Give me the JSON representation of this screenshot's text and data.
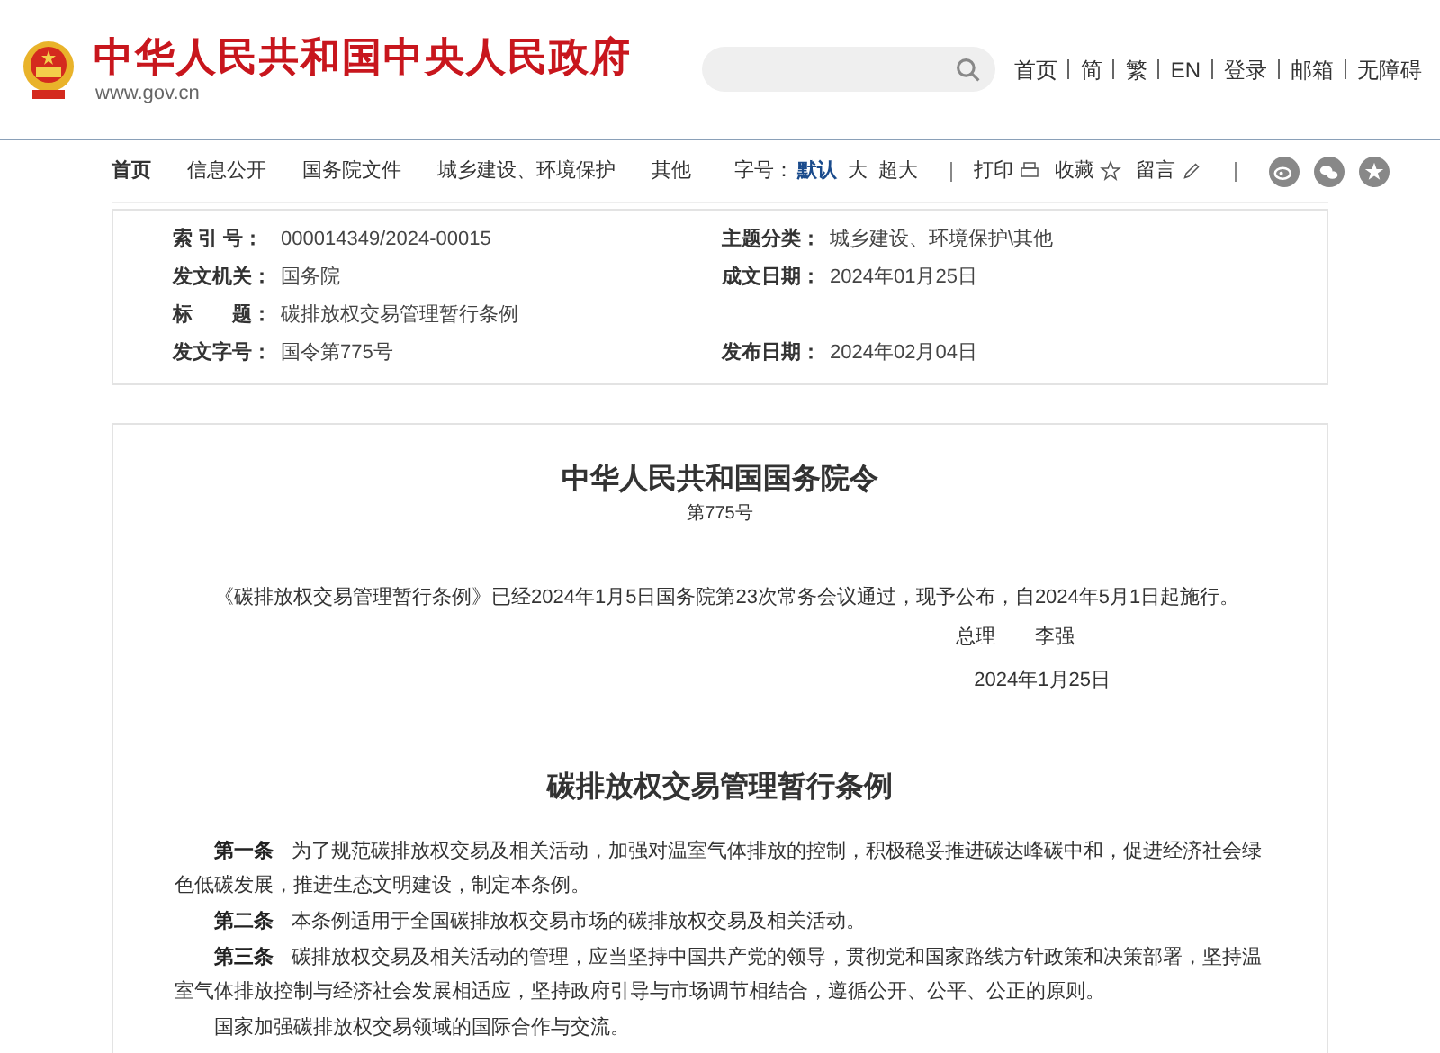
{
  "header": {
    "site_title": "中华人民共和国中央人民政府",
    "site_url": "www.gov.cn",
    "top_links": [
      "首页",
      "简",
      "繁",
      "EN",
      "登录",
      "邮箱",
      "无障碍"
    ]
  },
  "breadcrumb": [
    "首页",
    "信息公开",
    "国务院文件",
    "城乡建设、环境保护",
    "其他"
  ],
  "tools": {
    "font_size_label": "字号：",
    "font_sizes": [
      {
        "label": "默认",
        "selected": true
      },
      {
        "label": "大",
        "selected": false
      },
      {
        "label": "超大",
        "selected": false
      }
    ],
    "actions": [
      "打印",
      "收藏",
      "留言"
    ]
  },
  "metadata": [
    {
      "left": {
        "label": "索 引 号：",
        "value": "000014349/2024-00015"
      },
      "right": {
        "label": "主题分类：",
        "value": "城乡建设、环境保护\\其他"
      }
    },
    {
      "left": {
        "label": "发文机关：",
        "value": "国务院"
      },
      "right": {
        "label": "成文日期：",
        "value": "2024年01月25日"
      }
    },
    {
      "left": {
        "label": "标　　题：",
        "value": "碳排放权交易管理暂行条例"
      }
    },
    {
      "left": {
        "label": "发文字号：",
        "value": "国令第775号"
      },
      "right": {
        "label": "发布日期：",
        "value": "2024年02月04日"
      }
    }
  ],
  "order": {
    "title": "中华人民共和国国务院令",
    "number": "第775号",
    "text": "《碳排放权交易管理暂行条例》已经2024年1月5日国务院第23次常务会议通过，现予公布，自2024年5月1日起施行。",
    "signer_title": "总理",
    "signer_name": "李强",
    "date": "2024年1月25日"
  },
  "regulation": {
    "title": "碳排放权交易管理暂行条例",
    "paragraphs": [
      {
        "article": "第一条",
        "text": "为了规范碳排放权交易及相关活动，加强对温室气体排放的控制，积极稳妥推进碳达峰碳中和，促进经济社会绿色低碳发展，推进生态文明建设，制定本条例。"
      },
      {
        "article": "第二条",
        "text": "本条例适用于全国碳排放权交易市场的碳排放权交易及相关活动。"
      },
      {
        "article": "第三条",
        "text": "碳排放权交易及相关活动的管理，应当坚持中国共产党的领导，贯彻党和国家路线方针政策和决策部署，坚持温室气体排放控制与经济社会发展相适应，坚持政府引导与市场调节相结合，遵循公开、公平、公正的原则。"
      },
      {
        "text": "国家加强碳排放权交易领域的国际合作与交流。"
      }
    ]
  }
}
